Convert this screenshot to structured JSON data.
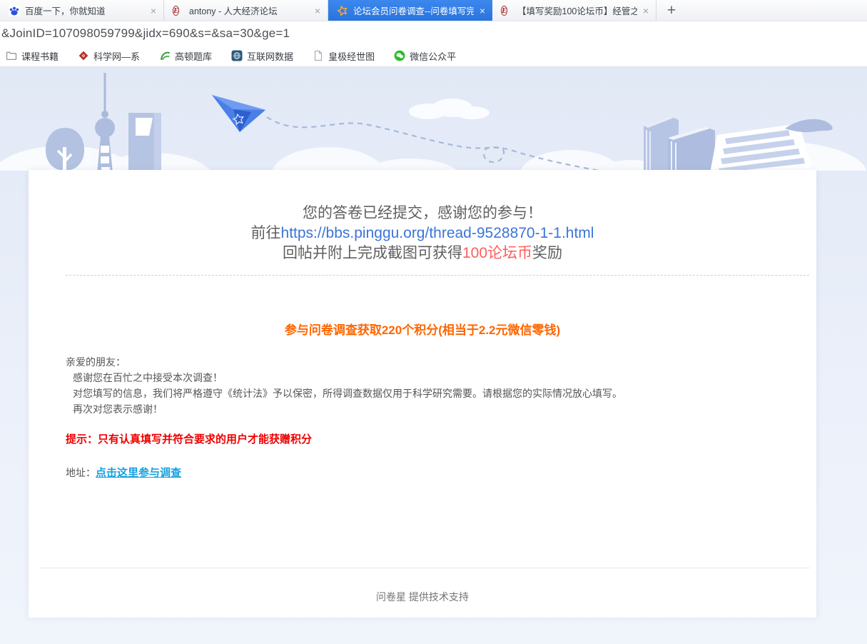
{
  "browser": {
    "tabs": [
      {
        "title": "百度一下，你就知道"
      },
      {
        "title": "antony - 人大经济论坛"
      },
      {
        "title": "论坛会员问卷调查--问卷填写完"
      },
      {
        "title": "【填写奖励100论坛币】经管之"
      }
    ],
    "close_label": "×",
    "new_tab_label": "+",
    "url": "&JoinID=107098059799&jidx=690&s=&sa=30&ge=1",
    "bookmarks": [
      {
        "label": "课程书籍"
      },
      {
        "label": "科学网—系"
      },
      {
        "label": "高顿题库"
      },
      {
        "label": "互联网数据"
      },
      {
        "label": "皇极经世图"
      },
      {
        "label": "微信公众平"
      }
    ]
  },
  "page": {
    "submit_message": {
      "line1": "您的答卷已经提交，感谢您的参与！",
      "line2_prefix": "前往",
      "line2_link": "https://bbs.pinggu.org/thread-9528870-1-1.html",
      "line3_prefix": "回帖并附上完成截图可获得",
      "line3_highlight": "100论坛币",
      "line3_suffix": "奖励"
    },
    "reward_heading": "参与问卷调查获取220个积分(相当于2.2元微信零钱)",
    "body": {
      "salutation": "亲爱的朋友：",
      "lines": [
        "感谢您在百忙之中接受本次调查！",
        "对您填写的信息，我们将严格遵守《统计法》予以保密，所得调查数据仅用于科学研究需要。请根据您的实际情况放心填写。",
        "再次对您表示感谢！"
      ]
    },
    "notice": "提示：只有认真填写并符合要求的用户才能获赠积分",
    "address_label": "地址：",
    "address_link": "点击这里参与调查",
    "footer": "问卷星 提供技术支持"
  },
  "colors": {
    "active_tab_blue": "#2e7de4",
    "thread_link_blue": "#3b74d9",
    "coin_red": "#ff5c5c",
    "notice_red": "#f00000",
    "reward_orange": "#ff6600",
    "survey_link_blue": "#14a1e0"
  }
}
